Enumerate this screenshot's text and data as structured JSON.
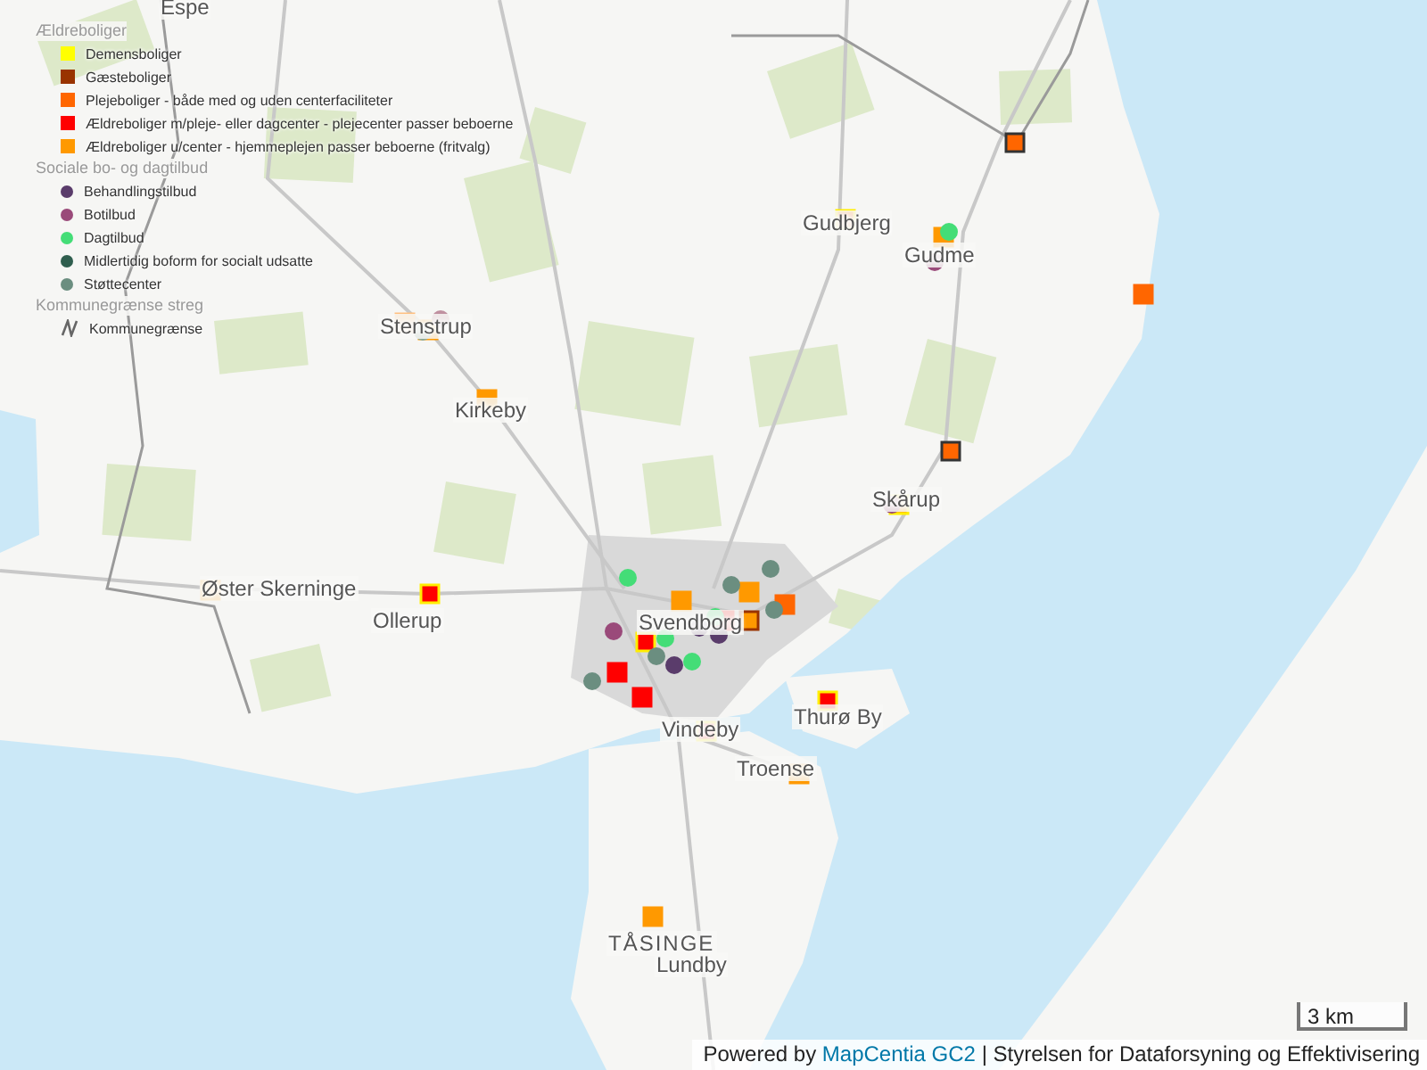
{
  "legend": {
    "groups": [
      {
        "title": "Ældreboliger",
        "items": [
          {
            "label": "Demensboliger",
            "kind": "square",
            "color": "#ffff00"
          },
          {
            "label": "Gæsteboliger",
            "kind": "square",
            "color": "#993300"
          },
          {
            "label": "Plejeboliger - både med og uden centerfaciliteter",
            "kind": "square",
            "color": "#ff6600"
          },
          {
            "label": "Ældreboliger m/pleje- eller dagcenter - plejecenter passer beboerne",
            "kind": "square",
            "color": "#ff0000"
          },
          {
            "label": "Ældreboliger u/center - hjemmeplejen passer beboerne (fritvalg)",
            "kind": "square",
            "color": "#ff9900"
          }
        ]
      },
      {
        "title": "Sociale bo- og dagtilbud",
        "items": [
          {
            "label": "Behandlingstilbud",
            "kind": "circle",
            "color": "#5a3c6b"
          },
          {
            "label": "Botilbud",
            "kind": "circle",
            "color": "#9a4a7a"
          },
          {
            "label": "Dagtilbud",
            "kind": "circle",
            "color": "#44dd77"
          },
          {
            "label": "Midlertidig boform for socialt udsatte",
            "kind": "circle",
            "color": "#2f5e4e"
          },
          {
            "label": "Støttecenter",
            "kind": "circle",
            "color": "#6b8e80"
          }
        ]
      },
      {
        "title": "Kommunegrænse streg",
        "items": [
          {
            "label": "Kommunegrænse",
            "kind": "line",
            "color": "#666666"
          }
        ]
      }
    ]
  },
  "place_labels": [
    {
      "label": "Espe"
    },
    {
      "label": "Gudbjerg"
    },
    {
      "label": "Gudme"
    },
    {
      "label": "Stenstrup"
    },
    {
      "label": "Kirkeby"
    },
    {
      "label": "Skårup"
    },
    {
      "label": "Øster Skerninge"
    },
    {
      "label": "Ollerup"
    },
    {
      "label": "Svendborg"
    },
    {
      "label": "Vindeby"
    },
    {
      "label": "Thurø By"
    },
    {
      "label": "Troense"
    },
    {
      "label": "TÅSINGE"
    },
    {
      "label": "Lundby"
    }
  ],
  "scale_bar": {
    "label": "3 km"
  },
  "attribution": {
    "prefix": "Powered by",
    "link": "MapCentia GC2",
    "suffix": "| Styrelsen for Dataforsyning og Effektivisering"
  }
}
